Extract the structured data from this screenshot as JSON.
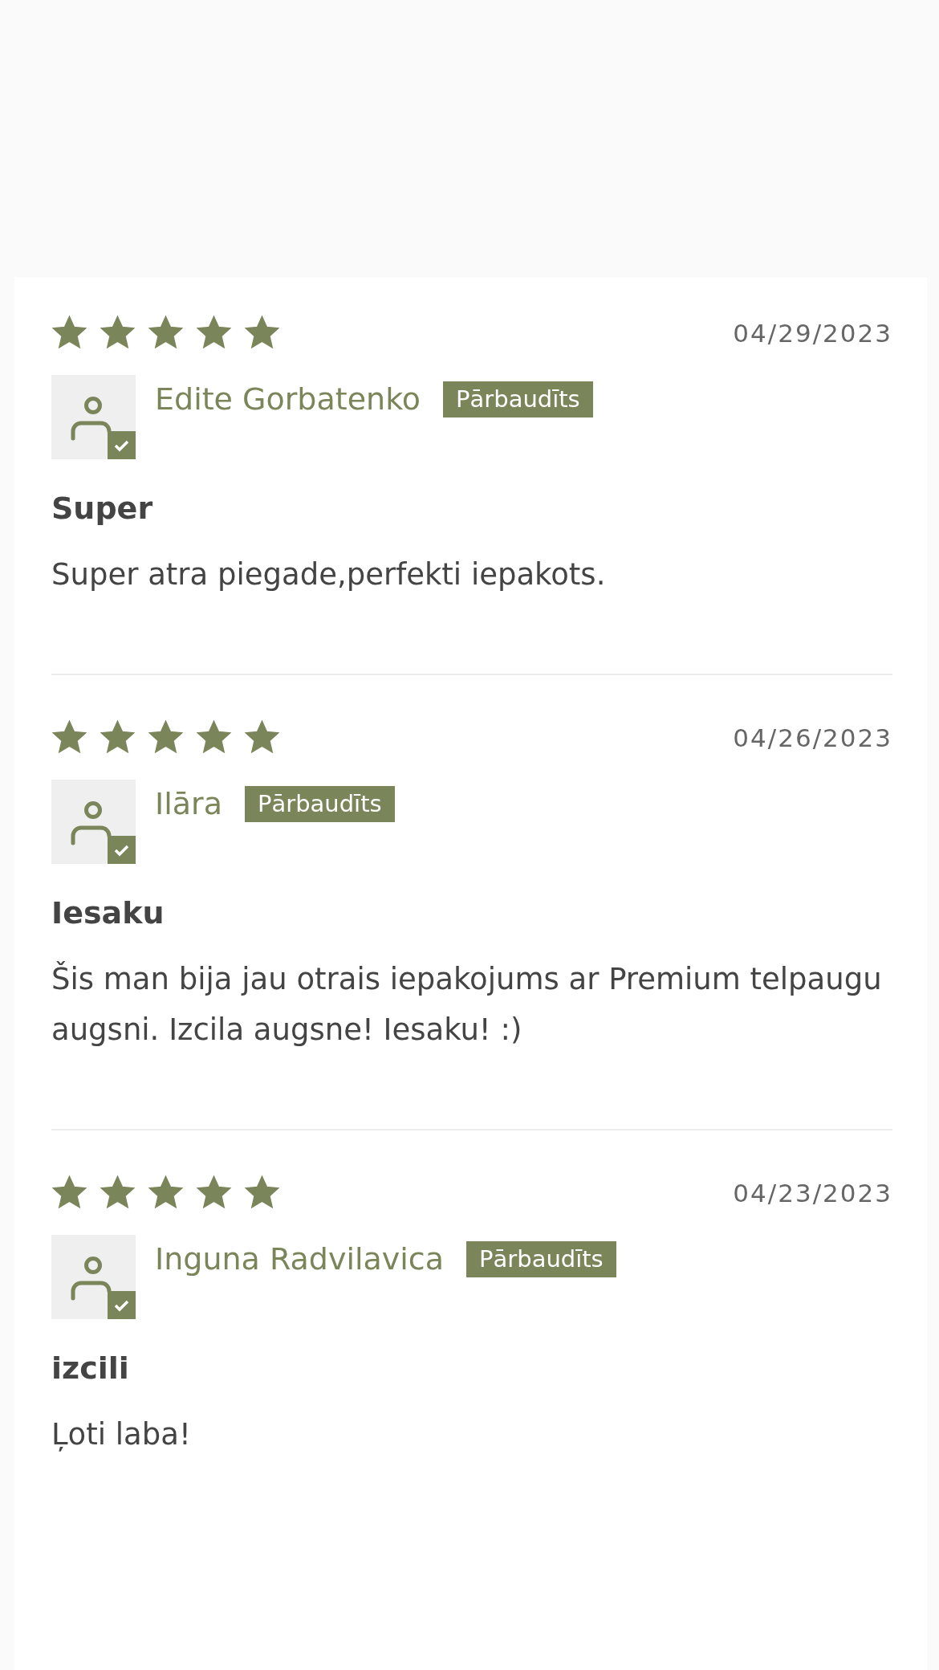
{
  "reviews": [
    {
      "stars": 5,
      "date": "04/29/2023",
      "author": "Edite Gorbatenko",
      "verified": true,
      "badge": "Pārbaudīts",
      "title": "Super",
      "body": "Super atra piegade,perfekti iepakots."
    },
    {
      "stars": 5,
      "date": "04/26/2023",
      "author": "Ilāra",
      "verified": true,
      "badge": "Pārbaudīts",
      "title": "Iesaku",
      "body": "Šis man bija jau otrais iepakojums ar Premium telpaugu augsni. Izcila augsne! Iesaku! :)"
    },
    {
      "stars": 5,
      "date": "04/23/2023",
      "author": "Inguna Radvilavica",
      "verified": true,
      "badge": "Pārbaudīts",
      "title": "izcili",
      "body": "Ļoti laba!"
    }
  ]
}
